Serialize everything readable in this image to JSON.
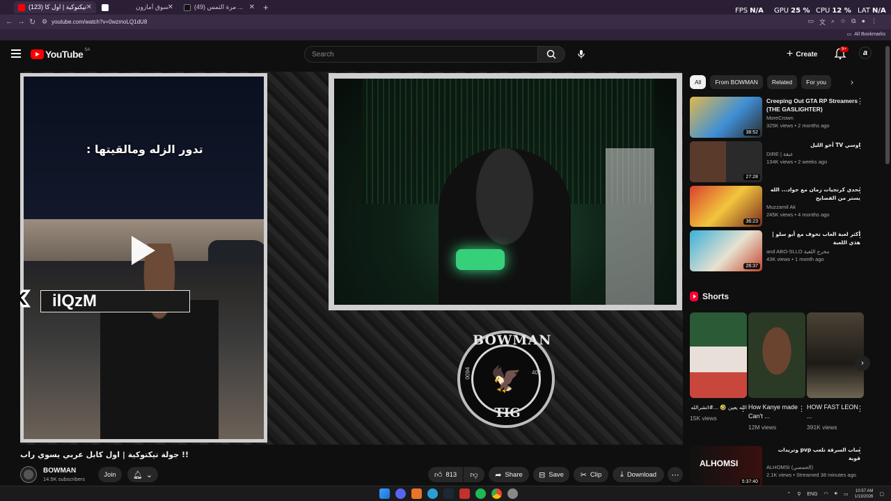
{
  "browser": {
    "tabs": [
      {
        "label": "(123) جولة تيكتوكية | اول كا..."
      },
      {
        "label": "عربة تسوق أمازون"
      },
      {
        "label": "(49) مرة الثمس ..."
      }
    ],
    "url": "youtube.com/watch?v=0wzmoLQ1dU8",
    "all_bookmarks": "All Bookmarks",
    "overlay": {
      "fps_label": "FPS",
      "fps_value": "N/A",
      "gpu_label": "GPU",
      "gpu_value": "25 %",
      "cpu_label": "CPU",
      "cpu_value": "12 %",
      "lat_label": "LAT",
      "lat_value": "N/A"
    }
  },
  "header": {
    "logo_text": "YouTube",
    "region": "SA",
    "search_placeholder": "Search",
    "create_label": "Create",
    "notifications_badge": "9+"
  },
  "player": {
    "tiktok_caption": "تدور الزله ومالقيتها :",
    "kick_name": "ilQzM",
    "logo_top": "BOWMAN",
    "logo_bottom": "TIG",
    "logo_left": "0094",
    "logo_right": "402"
  },
  "video": {
    "title": "!! جولة تيكتوكية | اول كابل عربي يسوي راب",
    "channel_name": "BOWMAN",
    "subscribers": "14.5K subscribers",
    "join_label": "Join",
    "like_count": "813",
    "share_label": "Share",
    "save_label": "Save",
    "clip_label": "Clip",
    "download_label": "Download"
  },
  "sidebar": {
    "chips": [
      "All",
      "From BOWMAN",
      "Related",
      "For you"
    ],
    "recommendations": [
      {
        "title": "Creeping Out GTA RP Streamers (THE GASLIGHTER)",
        "channel": "MoreCrown",
        "stats": "325K views • 2 months ago",
        "duration": "38:52",
        "rtl": false
      },
      {
        "title": "اوسي TV أخو الليل",
        "channel": "DIRE | عبقة",
        "stats": "134K views • 2 weeks ago",
        "duration": "27:28",
        "rtl": true
      },
      {
        "title": "تحدي كرتجيات زمان مع جواد... الله يستر من الفضايح",
        "channel": "Muzzamil Ak",
        "stats": "245K views • 4 months ago",
        "duration": "36:23",
        "rtl": true
      },
      {
        "title": "أكثر لعبة العاب تخوف مع أبو سلو | هذي اللعبة",
        "channel": "and ABO-SLLO مخرج اللعبة",
        "stats": "43K views • 1 month ago",
        "duration": "26:37",
        "rtl": true
      },
      {
        "title": "ساب السرقة تلعب pvp وتريدات قوية",
        "channel": "ALHOMSI (الحمصي)",
        "stats": "2.1K views • Streamed 38 minutes ago",
        "duration": "5:37:40",
        "rtl": true
      }
    ],
    "shorts_title": "Shorts",
    "shorts": [
      {
        "title": "الله يعين 🤣 ...#اتشرالله",
        "views": "15K views",
        "rtl": true
      },
      {
        "title": "How Kanye made Can't ...",
        "views": "12M views",
        "rtl": false
      },
      {
        "title": "HOW FAST LEON ...",
        "views": "391K views",
        "rtl": false
      }
    ],
    "live_thumb_text": "ALHOMSI"
  },
  "taskbar": {
    "lang": "ENG",
    "time": "10:57 AM",
    "date": "1/13/2026"
  },
  "colors": {
    "background": "#0f0f0f",
    "accent_red": "#ff0000",
    "browser_frame": "#3a2c47"
  }
}
